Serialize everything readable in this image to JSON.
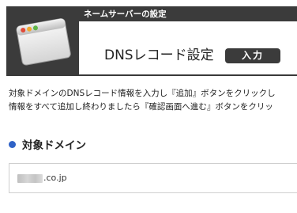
{
  "header": {
    "section_title": "ネームサーバーの設定",
    "page_heading": "DNSレコード設定",
    "step_badge": "入力"
  },
  "description": {
    "line1": "対象ドメインのDNSレコード情報を入力し『追加』ボタンをクリックし",
    "line2": "情報をすべて追加し終わりましたら『確認画面へ進む』ボタンをクリッ"
  },
  "target_domain": {
    "label": "対象ドメイン",
    "value_suffix": ".co.jp"
  },
  "colors": {
    "header_dark": "#3b3b3b",
    "accent_blue": "#2f62c6"
  }
}
